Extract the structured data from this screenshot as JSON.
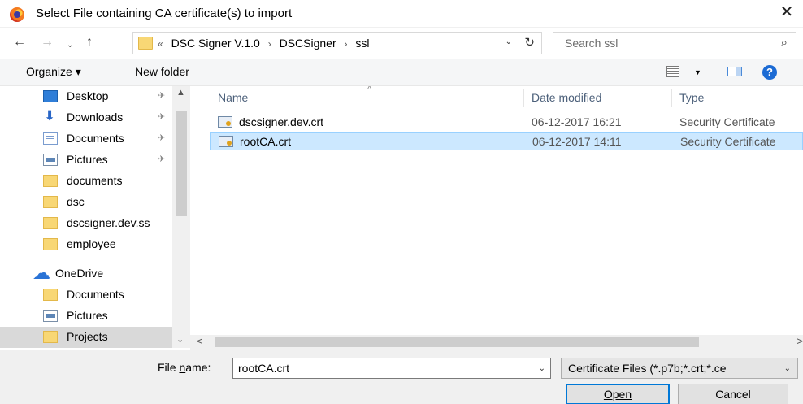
{
  "dialog": {
    "title": "Select File containing CA certificate(s) to import",
    "close_glyph": "✕"
  },
  "nav": {
    "back_glyph": "←",
    "forward_glyph": "→",
    "recent_glyph": "⌄",
    "up_glyph": "↑",
    "breadcrumb": [
      "«",
      "DSC Signer V.1.0",
      "›",
      "DSCSigner",
      "›",
      "ssl"
    ],
    "dropdown_glyph": "⌄",
    "refresh_glyph": "↻"
  },
  "search": {
    "placeholder": "Search ssl",
    "icon_glyph": "⌕"
  },
  "toolbar": {
    "organize_label": "Organize ▾",
    "new_folder_label": "New folder",
    "view_dropdown_glyph": "▼",
    "help_glyph": "?"
  },
  "sidebar": {
    "items": [
      {
        "label": "Desktop",
        "icon": "desktop-icon",
        "pinned": true
      },
      {
        "label": "Downloads",
        "icon": "download-icon",
        "pinned": true
      },
      {
        "label": "Documents",
        "icon": "documents-icon",
        "pinned": true
      },
      {
        "label": "Pictures",
        "icon": "pictures-icon",
        "pinned": true
      },
      {
        "label": "documents",
        "icon": "folder-icon",
        "pinned": false
      },
      {
        "label": "dsc",
        "icon": "folder-icon",
        "pinned": false
      },
      {
        "label": "dscsigner.dev.ss",
        "icon": "folder-icon",
        "pinned": false
      },
      {
        "label": "employee",
        "icon": "folder-icon",
        "pinned": false
      },
      {
        "label": "OneDrive",
        "icon": "onedrive-icon",
        "pinned": false
      },
      {
        "label": "Documents",
        "icon": "folder-icon",
        "pinned": false
      },
      {
        "label": "Pictures",
        "icon": "pictures-icon",
        "pinned": false
      },
      {
        "label": "Projects",
        "icon": "folder-icon",
        "pinned": false,
        "selected": true
      }
    ],
    "pin_glyph": "✈"
  },
  "columns": {
    "name": "Name",
    "date": "Date modified",
    "type": "Type"
  },
  "files": [
    {
      "name": "dscsigner.dev.crt",
      "date": "06-12-2017 16:21",
      "type": "Security Certificate",
      "selected": false
    },
    {
      "name": "rootCA.crt",
      "date": "06-12-2017 14:11",
      "type": "Security Certificate",
      "selected": true
    }
  ],
  "scroll": {
    "up": "▲",
    "down": "⌄",
    "left": "<",
    "right": ">"
  },
  "footer": {
    "file_name_label_prefix": "File ",
    "file_name_label_underlined": "n",
    "file_name_label_suffix": "ame:",
    "file_name_value": "rootCA.crt",
    "filter_value": "Certificate Files (*.p7b;*.crt;*.ce",
    "open_label": "Open",
    "cancel_label": "Cancel",
    "dropdown_glyph": "⌄"
  },
  "colors": {
    "selection_bg": "#cce8ff",
    "selection_border": "#99d1ff",
    "accent": "#0078d7",
    "sidebar_selected": "#d9d9d9"
  }
}
